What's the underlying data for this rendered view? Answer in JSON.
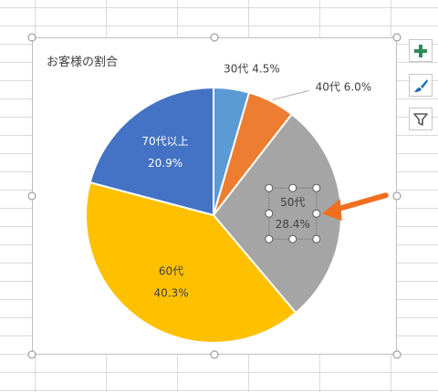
{
  "chart_data": {
    "type": "pie",
    "title": "お客様の割合",
    "slices": [
      {
        "label": "30代",
        "value": 4.5,
        "value_label": "4.5%",
        "color": "#5B9BD5"
      },
      {
        "label": "40代",
        "value": 6.0,
        "value_label": "6.0%",
        "color": "#ED7D31"
      },
      {
        "label": "50代",
        "value": 28.4,
        "value_label": "28.4%",
        "color": "#A5A5A5"
      },
      {
        "label": "60代",
        "value": 40.3,
        "value_label": "40.3%",
        "color": "#FFC000"
      },
      {
        "label": "70代以上",
        "value": 20.9,
        "value_label": "20.9%",
        "color": "#4472C4"
      }
    ],
    "start_angle_deg": 0,
    "direction": "clockwise",
    "selected_label": "50代"
  },
  "side_buttons": [
    {
      "name": "chart-elements-button",
      "icon": "plus-icon",
      "color": "#2E8B57"
    },
    {
      "name": "chart-styles-button",
      "icon": "brush-icon",
      "color": "#1E6FB8"
    },
    {
      "name": "chart-filters-button",
      "icon": "filter-icon",
      "color": "#595959"
    }
  ],
  "annotation": {
    "arrow_color": "#F07020"
  }
}
